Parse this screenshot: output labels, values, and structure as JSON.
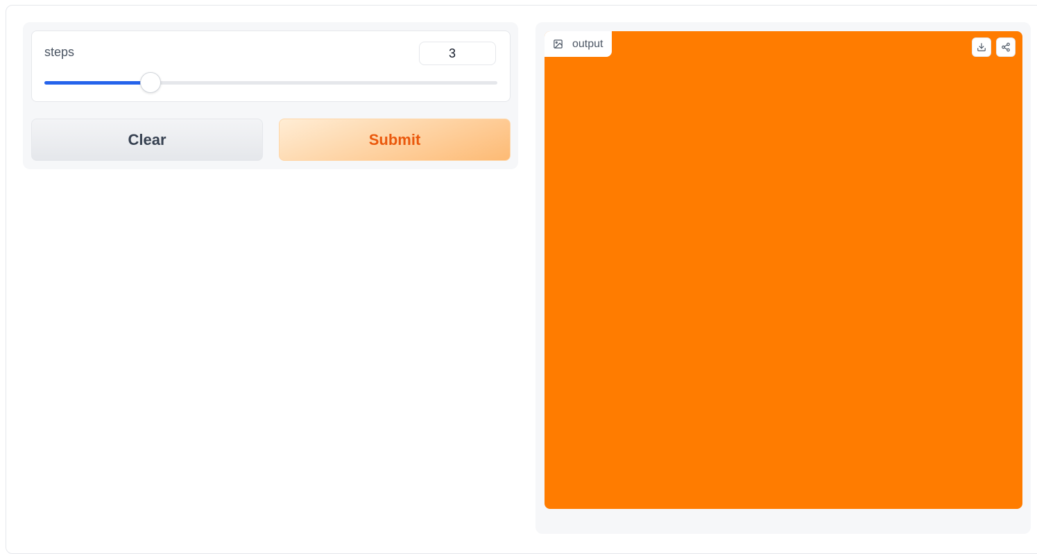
{
  "inputs": {
    "steps": {
      "label": "steps",
      "value": "3",
      "fraction": 0.234
    }
  },
  "actions": {
    "clear_label": "Clear",
    "submit_label": "Submit"
  },
  "output": {
    "label": "output",
    "image_color": "#ff7c00",
    "download_icon": "download-icon",
    "share_icon": "share-icon",
    "label_icon": "image-icon"
  },
  "colors": {
    "slider_accent": "#2563eb",
    "submit_text": "#ea580c",
    "submit_bg": "#fed7aa",
    "clear_text": "#374151"
  }
}
